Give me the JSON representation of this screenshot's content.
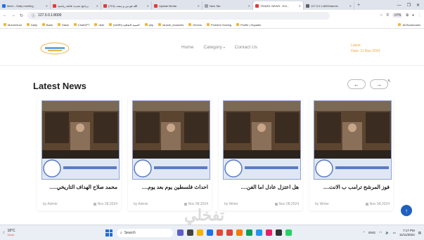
{
  "browser": {
    "tabs": [
      {
        "label": "Meet – Daily meeting",
        "color": "#1a73e8",
        "active": false
      },
      {
        "label": "برنامج تحديث فائقة رياضية",
        "color": "#e53935",
        "active": false
      },
      {
        "label": "(713) الله هو من و ينبغت",
        "color": "#e53935",
        "active": false
      },
      {
        "label": "Update Media",
        "color": "#e53935",
        "active": false
      },
      {
        "label": "New Tab",
        "color": "#9aa0a6",
        "active": false
      },
      {
        "label": "TRAVEL NEWS - Ent...",
        "color": "#e53935",
        "active": true
      },
      {
        "label": "127.0.0.1:8000/admin",
        "color": "#5f6368",
        "active": false
      }
    ],
    "new_tab_label": "+",
    "window_controls": [
      "—",
      "❐",
      "✕"
    ],
    "url": "127.0.0.1:8000",
    "vpn_label": "VPN",
    "bookmarks": [
      {
        "label": "Momentum"
      },
      {
        "label": "Daily"
      },
      {
        "label": "Bash"
      },
      {
        "label": "Slack"
      },
      {
        "label": "ChatGPT"
      },
      {
        "label": "deel"
      },
      {
        "label": "(UMRI) التنمية الثقافية"
      },
      {
        "label": "php"
      },
      {
        "label": "laravel_channels"
      },
      {
        "label": "Drivers"
      },
      {
        "label": "Problem Solving"
      },
      {
        "label": "Profile | Squadio"
      }
    ],
    "all_bookmarks_label": "All Bookmarks"
  },
  "site": {
    "nav": [
      "Home",
      "Category",
      "Contact Us"
    ],
    "nav_caret": "▾",
    "promo_lines": [
      "Latest",
      "Date: 11 Nov 2024"
    ],
    "section_title": "Latest News",
    "prev_arrow": "←",
    "next_arrow": "→",
    "cards": [
      {
        "title": "محمد صلاح الهداف التاريخي.....",
        "author": "by Admin",
        "date": "Nov 08,2024"
      },
      {
        "title": "احداث فلسطين يوم بعد يوم....",
        "author": "by Admin",
        "date": "Nov 08,2024"
      },
      {
        "title": "هل اعتزل عادل اما الفن....",
        "author": "by Writer",
        "date": "Nov 08,2024"
      },
      {
        "title": "فوز المرشح ترامب ب الانت....",
        "author": "by Writer",
        "date": "Nov 08,2024"
      }
    ],
    "scroll_top_label": "↑",
    "watermark": "تفخلي"
  },
  "taskbar": {
    "weather_temp": "18°C",
    "weather_cond": "Clear",
    "search_placeholder": "Search",
    "tray_lang": "ENG",
    "time": "7:17 PM",
    "date": "11/11/2024"
  }
}
